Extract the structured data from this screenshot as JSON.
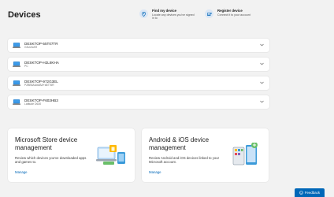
{
  "page": {
    "title": "Devices"
  },
  "quick_actions": [
    {
      "title": "Find my device",
      "description_lines": [
        "Locate any devices you've signed",
        "in to"
      ]
    },
    {
      "title": "Register device",
      "description_lines": [
        "Connect it to your account"
      ]
    }
  ],
  "devices": [
    {
      "name": "DESKTOP-55T07TR",
      "subtitle": "G3U2UAR"
    },
    {
      "name": "DESKTOP-H2L8KHA",
      "subtitle": "PC"
    },
    {
      "name": "DESKTOP-972G3EL",
      "subtitle": "P2BB5AA#ABA+a8776R"
    },
    {
      "name": "DESKTOP-F602HB3",
      "subtitle": "Latitude D630"
    }
  ],
  "promos": [
    {
      "title": "Microsoft Store device management",
      "description": "Review which devices you've downloaded apps and games to.",
      "link": "Manage"
    },
    {
      "title": "Android & iOS device management",
      "description": "Review Android and iOS devices linked to your Microsoft account.",
      "link": "Manage"
    }
  ],
  "feedback": {
    "label": "Feedback"
  },
  "colors": {
    "accent": "#0067b8",
    "background": "#f2f2f2",
    "card": "#ffffff"
  }
}
